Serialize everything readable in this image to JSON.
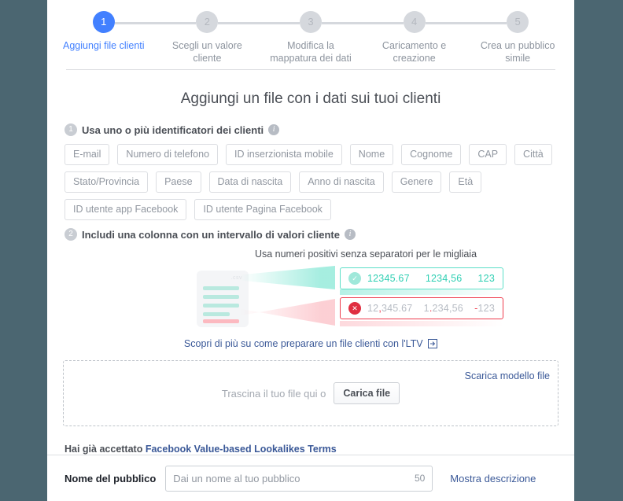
{
  "stepper": {
    "steps": [
      {
        "number": "1",
        "label": "Aggiungi file clienti",
        "active": true
      },
      {
        "number": "2",
        "label": "Scegli un valore cliente",
        "active": false
      },
      {
        "number": "3",
        "label": "Modifica la mappatura dei dati",
        "active": false
      },
      {
        "number": "4",
        "label": "Caricamento e creazione",
        "active": false
      },
      {
        "number": "5",
        "label": "Crea un pubblico simile",
        "active": false
      }
    ],
    "active_color": "#4280ff",
    "inactive_color": "#d5d8dd"
  },
  "main": {
    "title": "Aggiungi un file con i dati sui tuoi clienti",
    "section1": {
      "number": "1",
      "title": "Usa uno o più identificatori dei clienti",
      "info_icon": "info-icon",
      "chips": [
        "E-mail",
        "Numero di telefono",
        "ID inserzionista mobile",
        "Nome",
        "Cognome",
        "CAP",
        "Città",
        "Stato/Provincia",
        "Paese",
        "Data di nascita",
        "Anno di nascita",
        "Genere",
        "Età",
        "ID utente app Facebook",
        "ID utente Pagina Facebook"
      ]
    },
    "section2": {
      "number": "2",
      "title": "Includi una colonna con un intervallo di valori cliente",
      "info_icon": "info-icon",
      "caption": "Usa numeri positivi senza separatori per le migliaia",
      "csv_label": ".csv",
      "valid_row": {
        "icon": "check-icon",
        "values": [
          "12345.67",
          "1234,56",
          "123"
        ],
        "color": "#2fcfb3"
      },
      "invalid_row": {
        "icon": "close-icon",
        "values": [
          [
            {
              "t": "12",
              "sep": true
            },
            {
              "t": ",",
              "sep": true
            },
            {
              "t": "345.67",
              "sep": false
            }
          ],
          [
            {
              "t": "1",
              "sep": false
            },
            {
              "t": ".",
              "sep": true
            },
            {
              "t": "234,56",
              "sep": false
            }
          ],
          [
            {
              "t": "-",
              "sep": true
            },
            {
              "t": "123",
              "sep": false
            }
          ]
        ],
        "color": "#ee3c4d"
      },
      "learn_more": "Scopri di più su come preparare un file clienti con l'LTV",
      "learn_more_icon": "external-link-icon"
    },
    "dropzone": {
      "drag_text": "Trascina il tuo file qui o",
      "upload_button": "Carica file",
      "download_template": "Scarica modello file"
    },
    "terms": {
      "prefix": "Hai già accettato",
      "link": "Facebook Value-based Lookalikes Terms"
    }
  },
  "footer": {
    "label": "Nome del pubblico",
    "placeholder": "Dai un nome al tuo pubblico",
    "value": "",
    "char_count": "50",
    "show_description": "Mostra descrizione"
  }
}
